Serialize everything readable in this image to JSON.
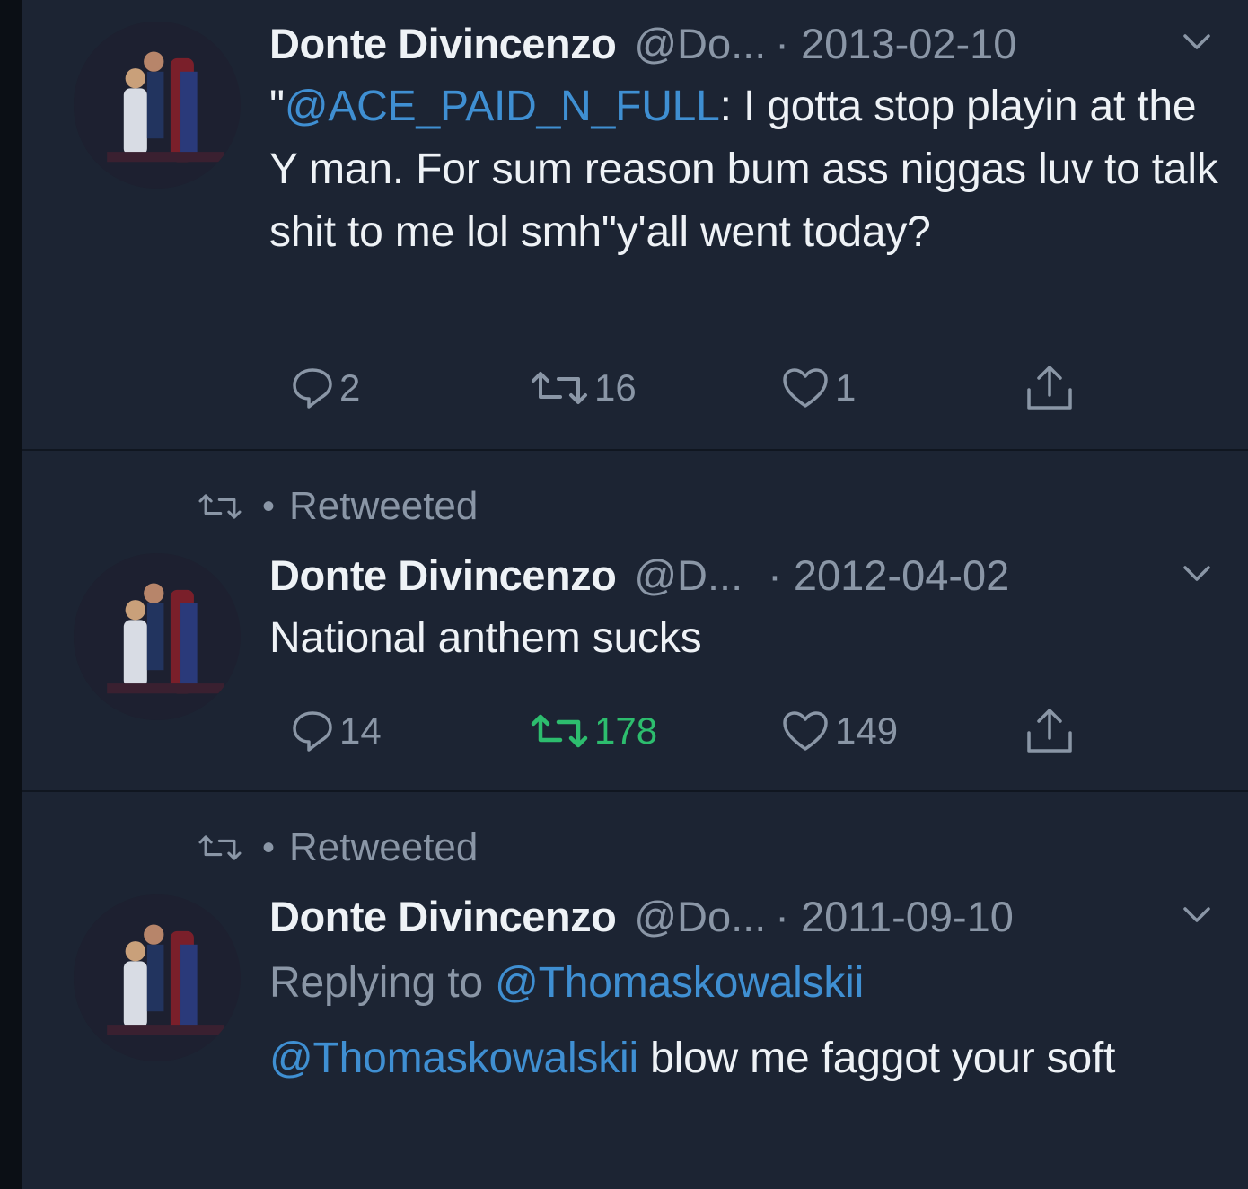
{
  "tweets": [
    {
      "retweeted": false,
      "name": "Donte Divincenzo",
      "handle": "@Do...",
      "date": "· 2013-02-10",
      "text_parts": [
        {
          "text": "\"",
          "mention": false
        },
        {
          "text": "@ACE_PAID_N_FULL",
          "mention": true
        },
        {
          "text": ": I gotta stop playin at the Y man. For sum reason bum ass niggas luv to talk shit to me lol smh\"y'all went today?",
          "mention": false
        }
      ],
      "replies": "2",
      "retweets": "16",
      "likes": "1",
      "retweet_active": false
    },
    {
      "retweeted": true,
      "retweeted_label": "Retweeted",
      "name": "Donte Divincenzo",
      "handle": "@D...",
      "date": "· 2012-04-02",
      "text_parts": [
        {
          "text": "National anthem sucks",
          "mention": false
        }
      ],
      "replies": "14",
      "retweets": "178",
      "likes": "149",
      "retweet_active": true
    },
    {
      "retweeted": true,
      "retweeted_label": "Retweeted",
      "name": "Donte Divincenzo",
      "handle": "@Do...",
      "date": "· 2011-09-10",
      "replying_prefix": "Replying to",
      "replying_to": "@Thomaskowalskii",
      "text_parts": [
        {
          "text": "@Thomaskowalskii",
          "mention": true
        },
        {
          "text": " blow me faggot your soft",
          "mention": false
        }
      ]
    }
  ],
  "colors": {
    "background": "#1c2433",
    "mention": "#3f8fd2",
    "muted": "#8a96a6",
    "retweet_active": "#2dbd6e"
  },
  "icons": [
    "avatar-photo",
    "retweet-icon",
    "chevron-down-icon",
    "reply-icon",
    "like-icon",
    "share-icon"
  ]
}
